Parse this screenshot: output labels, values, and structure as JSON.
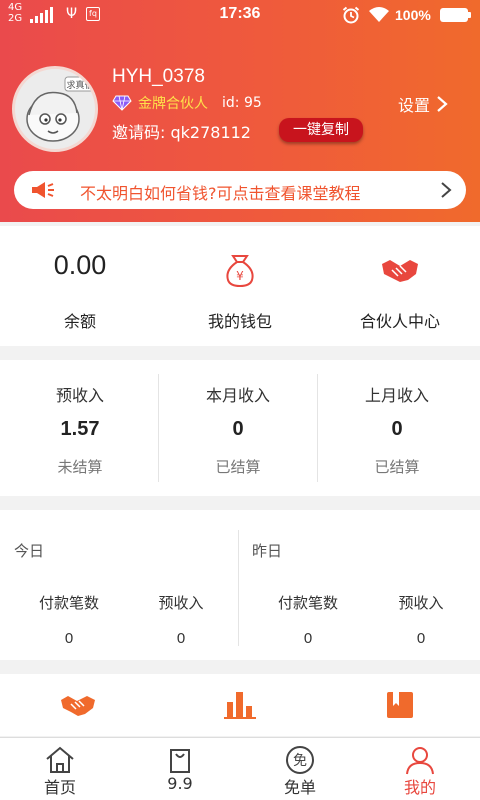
{
  "status_bar": {
    "network_top": "4G",
    "network_bottom": "2G",
    "app_badge": "fq",
    "time": "17:36",
    "battery": "100%"
  },
  "profile": {
    "username": "HYH_0378",
    "level": "金牌合伙人",
    "uid": "id: 95",
    "invite_code": "邀请码: qk278112",
    "copy_button": "一键复制",
    "settings": "设置",
    "avatar_text": "求真伯"
  },
  "notice": {
    "text": "不太明白如何省钱?可点击查看课堂教程"
  },
  "wallet": {
    "balance_value": "0.00",
    "balance_label": "余额",
    "wallet_label": "我的钱包",
    "partner_label": "合伙人中心"
  },
  "income": [
    {
      "title": "预收入",
      "value": "1.57",
      "sub": "未结算"
    },
    {
      "title": "本月收入",
      "value": "0",
      "sub": "已结算"
    },
    {
      "title": "上月收入",
      "value": "0",
      "sub": "已结算"
    }
  ],
  "daily": {
    "today": {
      "title": "今日",
      "orders_label": "付款笔数",
      "orders_value": "0",
      "income_label": "预收入",
      "income_value": "0"
    },
    "yesterday": {
      "title": "昨日",
      "orders_label": "付款笔数",
      "orders_value": "0",
      "income_label": "预收入",
      "income_value": "0"
    }
  },
  "tools": [
    {
      "icon": "handshake-icon"
    },
    {
      "icon": "bar-chart-icon"
    },
    {
      "icon": "orders-icon"
    }
  ],
  "tabbar": {
    "items": [
      {
        "label": "首页",
        "icon": "home-icon"
      },
      {
        "label": "9.9",
        "icon": "shopping-bag-icon"
      },
      {
        "label": "免单",
        "icon": "free-icon",
        "icon_text": "免"
      },
      {
        "label": "我的",
        "icon": "profile-icon",
        "active": true
      }
    ]
  },
  "colors": {
    "accent": "#e8473e",
    "header_start": "#ea4a4c",
    "header_end": "#f06a2c",
    "level_gold": "#ffe14a",
    "copy_button": "#c8141d",
    "notice_text": "#f0542f"
  }
}
